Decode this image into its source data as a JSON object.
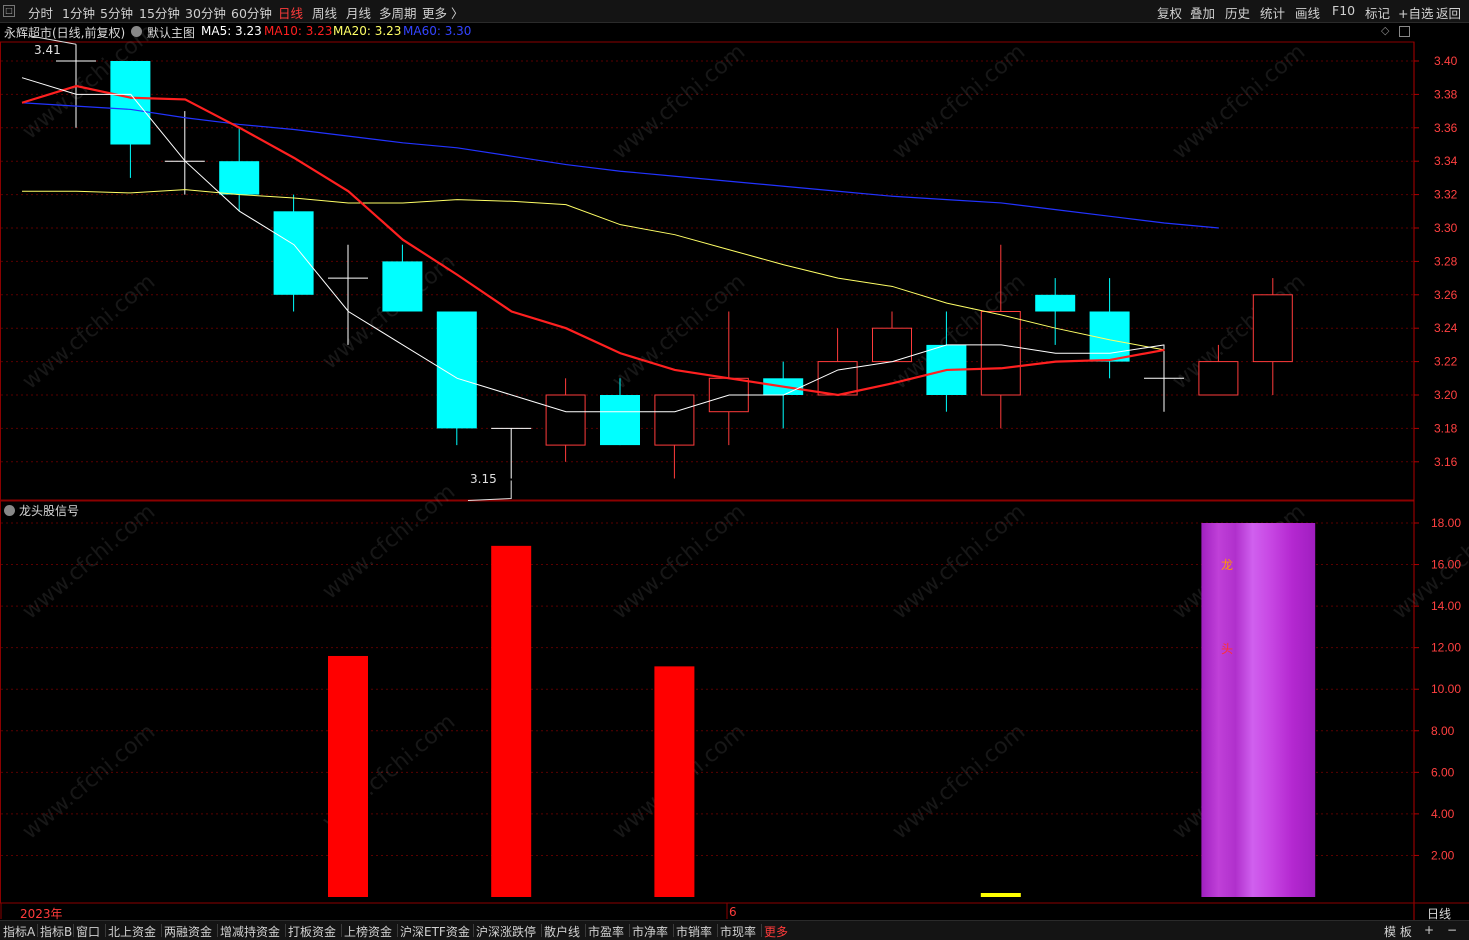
{
  "toolbar": {
    "system_glyph": "□",
    "periods": [
      "分时",
      "1分钟",
      "5分钟",
      "15分钟",
      "30分钟",
      "60分钟",
      "日线",
      "周线",
      "月线",
      "多周期",
      "更多 〉"
    ],
    "active_period": "日线",
    "right_items": [
      "复权",
      "叠加",
      "历史",
      "统计",
      "画线",
      "F10",
      "标记",
      "+自选",
      "返回"
    ]
  },
  "main_panel": {
    "stock_title": "永辉超市(日线,前复权)",
    "template": "默认主图",
    "ma5_label": "MA5: 3.23",
    "ma10_label": "MA10: 3.23",
    "ma20_label": "MA20: 3.23",
    "ma60_label": "MA60: 3.30",
    "high_marker": "3.41",
    "low_marker": "3.15"
  },
  "sub_panel": {
    "title": "龙头股信号",
    "bar_text_1": "龙",
    "bar_text_2": "头"
  },
  "x_axis": {
    "year_label": "2023年",
    "month_label": "6",
    "period_label": "日线"
  },
  "bottom_tabs": [
    "指标A",
    "指标B",
    "窗口",
    "北上资金",
    "两融资金",
    "增减持资金",
    "打板资金",
    "上榜资金",
    "沪深ETF资金",
    "沪深涨跌停",
    "散户线",
    "市盈率",
    "市净率",
    "市销率",
    "市现率",
    "更多"
  ],
  "bottom_active": "更多",
  "bottom_right": [
    "模 板",
    "+",
    "−"
  ],
  "watermark": "www.cfchi.com",
  "colors": {
    "up": "#ff3b3b",
    "down": "#00ffff",
    "ma5": "#ffffff",
    "ma10": "#ff2020",
    "ma20": "#ffff66",
    "ma60": "#2233ff",
    "signal": "#ff0000",
    "leader": "#c040e0"
  },
  "chart_data": [
    {
      "type": "candlestick",
      "title": "永辉超市(日线,前复权)",
      "ylim": [
        3.145,
        3.415
      ],
      "y_ticks": [
        "3.40",
        "3.38",
        "3.36",
        "3.34",
        "3.32",
        "3.30",
        "3.28",
        "3.26",
        "3.24",
        "3.22",
        "3.20",
        "3.18",
        "3.16"
      ],
      "candles": [
        {
          "o": 3.4,
          "c": 3.4,
          "h": 3.41,
          "l": 3.36
        },
        {
          "o": 3.4,
          "c": 3.35,
          "h": 3.4,
          "l": 3.33
        },
        {
          "o": 3.34,
          "c": 3.34,
          "h": 3.37,
          "l": 3.32
        },
        {
          "o": 3.34,
          "c": 3.32,
          "h": 3.36,
          "l": 3.31
        },
        {
          "o": 3.31,
          "c": 3.26,
          "h": 3.32,
          "l": 3.25
        },
        {
          "o": 3.27,
          "c": 3.27,
          "h": 3.29,
          "l": 3.23
        },
        {
          "o": 3.28,
          "c": 3.25,
          "h": 3.29,
          "l": 3.25
        },
        {
          "o": 3.25,
          "c": 3.18,
          "h": 3.25,
          "l": 3.17
        },
        {
          "o": 3.18,
          "c": 3.18,
          "h": 3.18,
          "l": 3.15
        },
        {
          "o": 3.17,
          "c": 3.2,
          "h": 3.21,
          "l": 3.16
        },
        {
          "o": 3.2,
          "c": 3.17,
          "h": 3.21,
          "l": 3.17
        },
        {
          "o": 3.17,
          "c": 3.2,
          "h": 3.2,
          "l": 3.15
        },
        {
          "o": 3.19,
          "c": 3.21,
          "h": 3.25,
          "l": 3.17
        },
        {
          "o": 3.21,
          "c": 3.2,
          "h": 3.22,
          "l": 3.18
        },
        {
          "o": 3.2,
          "c": 3.22,
          "h": 3.24,
          "l": 3.2
        },
        {
          "o": 3.22,
          "c": 3.24,
          "h": 3.25,
          "l": 3.22
        },
        {
          "o": 3.23,
          "c": 3.2,
          "h": 3.25,
          "l": 3.19
        },
        {
          "o": 3.2,
          "c": 3.25,
          "h": 3.29,
          "l": 3.18
        },
        {
          "o": 3.26,
          "c": 3.25,
          "h": 3.27,
          "l": 3.23
        },
        {
          "o": 3.25,
          "c": 3.22,
          "h": 3.27,
          "l": 3.21
        },
        {
          "o": 3.21,
          "c": 3.21,
          "h": 3.23,
          "l": 3.19
        },
        {
          "o": 3.2,
          "c": 3.22,
          "h": 3.23,
          "l": 3.2
        },
        {
          "o": 3.22,
          "c": 3.26,
          "h": 3.27,
          "l": 3.2
        }
      ],
      "ma5": [
        3.39,
        3.38,
        3.38,
        3.34,
        3.31,
        3.29,
        3.25,
        3.23,
        3.21,
        3.2,
        3.19,
        3.19,
        3.19,
        3.2,
        3.2,
        3.215,
        3.22,
        3.23,
        3.23,
        3.225,
        3.225,
        3.23
      ],
      "ma10": [
        3.375,
        3.385,
        3.378,
        3.377,
        3.36,
        3.342,
        3.322,
        3.293,
        3.272,
        3.25,
        3.24,
        3.225,
        3.215,
        3.21,
        3.205,
        3.2,
        3.207,
        3.215,
        3.216,
        3.22,
        3.221,
        3.227
      ],
      "ma20": [
        3.322,
        3.322,
        3.321,
        3.323,
        3.32,
        3.318,
        3.315,
        3.315,
        3.317,
        3.316,
        3.314,
        3.302,
        3.296,
        3.287,
        3.278,
        3.27,
        3.265,
        3.255,
        3.248,
        3.24,
        3.233,
        3.227
      ],
      "ma60": [
        3.375,
        3.373,
        3.371,
        3.366,
        3.362,
        3.359,
        3.355,
        3.351,
        3.348,
        3.343,
        3.338,
        3.334,
        3.331,
        3.328,
        3.325,
        3.322,
        3.319,
        3.317,
        3.315,
        3.311,
        3.307,
        3.303,
        3.3
      ]
    },
    {
      "type": "bar",
      "title": "龙头股信号",
      "ylim": [
        0,
        19.0
      ],
      "y_ticks": [
        "18.00",
        "16.00",
        "14.00",
        "12.00",
        "10.00",
        "8.00",
        "6.00",
        "4.00",
        "2.00"
      ],
      "series": [
        {
          "values": [
            {
              "i": 5,
              "v": 11.6
            },
            {
              "i": 8,
              "v": 16.9
            },
            {
              "i": 11,
              "v": 11.1
            },
            {
              "i": 17,
              "v": 0.25
            }
          ]
        },
        {
          "values": [
            {
              "from": 21,
              "to": 23,
              "v": 18.0
            }
          ]
        }
      ]
    }
  ]
}
